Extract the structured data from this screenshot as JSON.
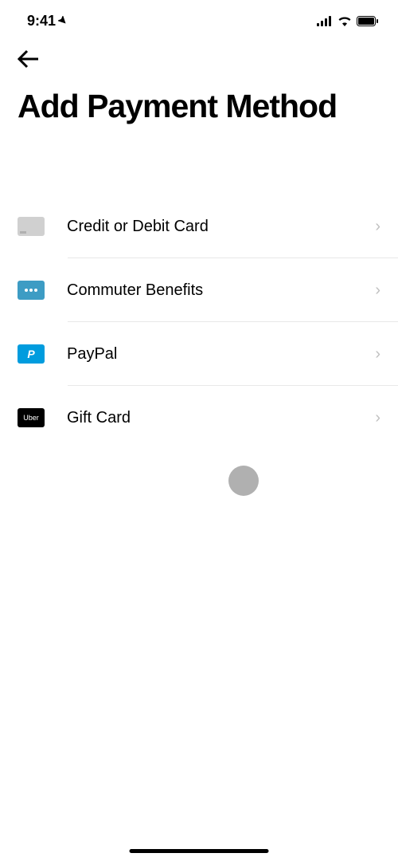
{
  "statusBar": {
    "time": "9:41"
  },
  "page": {
    "title": "Add Payment Method"
  },
  "paymentMethods": [
    {
      "label": "Credit or Debit Card",
      "iconType": "card"
    },
    {
      "label": "Commuter Benefits",
      "iconType": "commuter"
    },
    {
      "label": "PayPal",
      "iconType": "paypal"
    },
    {
      "label": "Gift Card",
      "iconType": "uber"
    }
  ],
  "icons": {
    "paypalText": "P",
    "uberText": "Uber",
    "commuterText": "⬚⬚⬚"
  }
}
